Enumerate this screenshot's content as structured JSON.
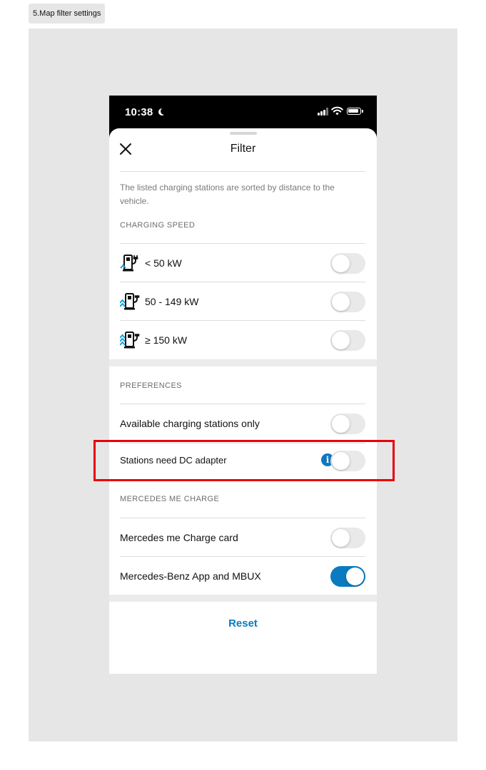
{
  "frame_label": "5.Map filter settings",
  "status_bar": {
    "time": "10:38"
  },
  "sheet": {
    "title": "Filter",
    "note": "The listed charging stations are sorted by distance to the vehicle."
  },
  "charging_speed": {
    "header": "CHARGING SPEED",
    "items": [
      {
        "label": "< 50 kW",
        "toggle_on": false,
        "icon": "charger-slow-icon"
      },
      {
        "label": "50 - 149 kW",
        "toggle_on": false,
        "icon": "charger-fast-icon"
      },
      {
        "label": "≥ 150 kW",
        "toggle_on": false,
        "icon": "charger-ultrafast-icon"
      }
    ]
  },
  "preferences": {
    "header": "PREFERENCES",
    "items": [
      {
        "label": "Available charging stations only",
        "toggle_on": false
      },
      {
        "label": "Stations need DC adapter",
        "toggle_on": false,
        "info_icon": "i"
      }
    ]
  },
  "mercedes_me_charge": {
    "header": "MERCEDES ME CHARGE",
    "items": [
      {
        "label": "Mercedes me Charge card",
        "toggle_on": false
      },
      {
        "label": "Mercedes-Benz App and MBUX",
        "toggle_on": true
      }
    ]
  },
  "footer": {
    "reset_label": "Reset"
  },
  "colors": {
    "accent": "#0a7bc0",
    "highlight": "#e8000b",
    "info": "#1078c2"
  }
}
